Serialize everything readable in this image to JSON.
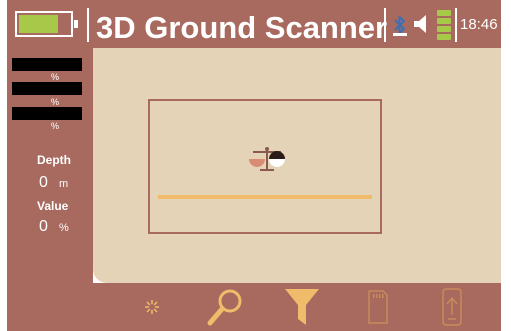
{
  "header": {
    "title": "3D Ground Scanner",
    "clock": "18:46",
    "battery_level": 0.78,
    "signal_bars": 4
  },
  "left_panel": {
    "channels": [
      {
        "unit": "%"
      },
      {
        "unit": "%"
      },
      {
        "unit": "%"
      }
    ],
    "depth": {
      "label": "Depth",
      "value": "0",
      "unit": "m"
    },
    "reading": {
      "label": "Value",
      "value": "0",
      "unit": "%"
    }
  },
  "scan": {
    "progress": 1.0
  },
  "toolbar": {
    "buttons": [
      {
        "icon": "sparkle-icon",
        "enabled": true
      },
      {
        "icon": "search-icon",
        "enabled": true
      },
      {
        "icon": "filter-icon",
        "enabled": true
      },
      {
        "icon": "sd-card-icon",
        "enabled": false
      },
      {
        "icon": "phone-upload-icon",
        "enabled": false
      }
    ]
  },
  "colors": {
    "frame": "#a86a5e",
    "background": "#e4d3b6",
    "accent": "#f0bb6a",
    "battery": "#a8c84a",
    "text": "#ffffff"
  }
}
